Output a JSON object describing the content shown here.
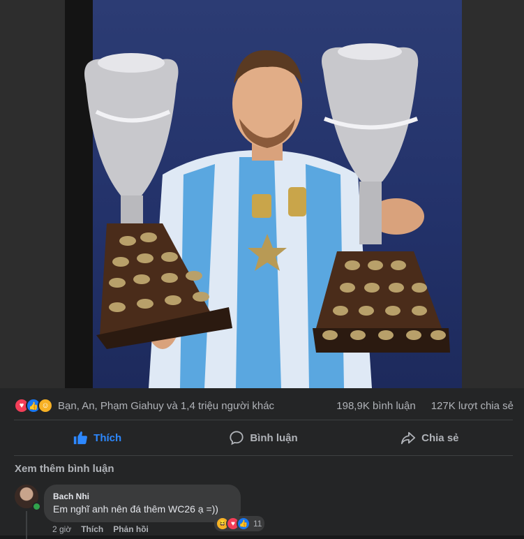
{
  "post": {
    "reactions": {
      "icons": [
        "love-icon",
        "like-icon",
        "care-icon"
      ],
      "names_text": "Bạn, An, Phạm Giahuy và 1,4 triệu người khác",
      "comments_count": "198,9K bình luận",
      "shares_count": "127K lượt chia sẻ"
    },
    "actions": {
      "like_label": "Thích",
      "comment_label": "Bình luận",
      "share_label": "Chia sẻ"
    },
    "colors": {
      "accent": "#2d88ff",
      "background": "#242526",
      "bubble": "#3a3b3c"
    }
  },
  "comments": {
    "view_more_label": "Xem thêm bình luận",
    "items": [
      {
        "author": "Bach Nhi",
        "text": "Em nghĩ anh nên đá thêm WC26 ạ =))",
        "time": "2 giờ",
        "like_label": "Thích",
        "reply_label": "Phản hồi",
        "reaction_count": "11"
      }
    ]
  }
}
